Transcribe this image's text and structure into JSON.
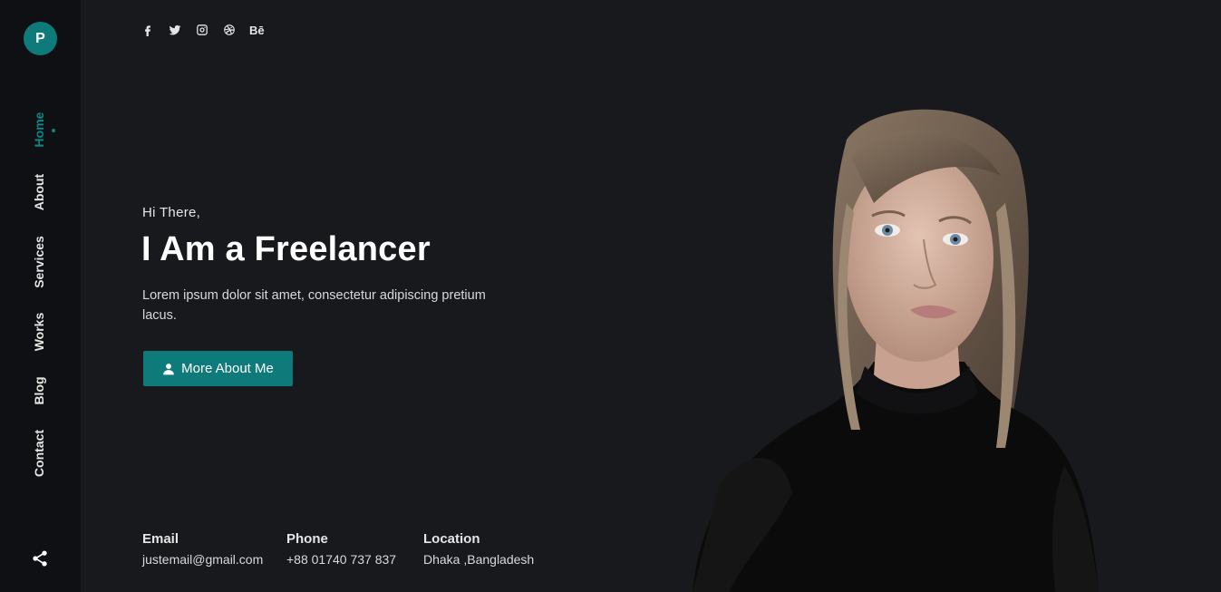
{
  "brand": {
    "logo_letter": "P"
  },
  "nav": {
    "items": [
      {
        "label": "Home",
        "active": true
      },
      {
        "label": "About",
        "active": false
      },
      {
        "label": "Services",
        "active": false
      },
      {
        "label": "Works",
        "active": false
      },
      {
        "label": "Blog",
        "active": false
      },
      {
        "label": "Contact",
        "active": false
      }
    ],
    "share_icon": "share-icon"
  },
  "social": {
    "icons": [
      "facebook-icon",
      "twitter-icon",
      "instagram-icon",
      "dribbble-icon",
      "behance-icon"
    ],
    "behance_label": "Bē"
  },
  "hero": {
    "greeting": "Hi There,",
    "headline": "I Am a Freelancer",
    "description": "Lorem ipsum dolor sit amet, consectetur adipiscing pretium lacus.",
    "cta_label": "More About Me",
    "cta_icon": "user-icon"
  },
  "contact": {
    "email_label": "Email",
    "email_value": "justemail@gmail.com",
    "phone_label": "Phone",
    "phone_value": "+88 01740 737 837",
    "location_label": "Location",
    "location_value": "Dhaka ,Bangladesh"
  },
  "colors": {
    "accent": "#0f7a7a",
    "background": "#18191d",
    "sidebar": "#0f1013"
  }
}
